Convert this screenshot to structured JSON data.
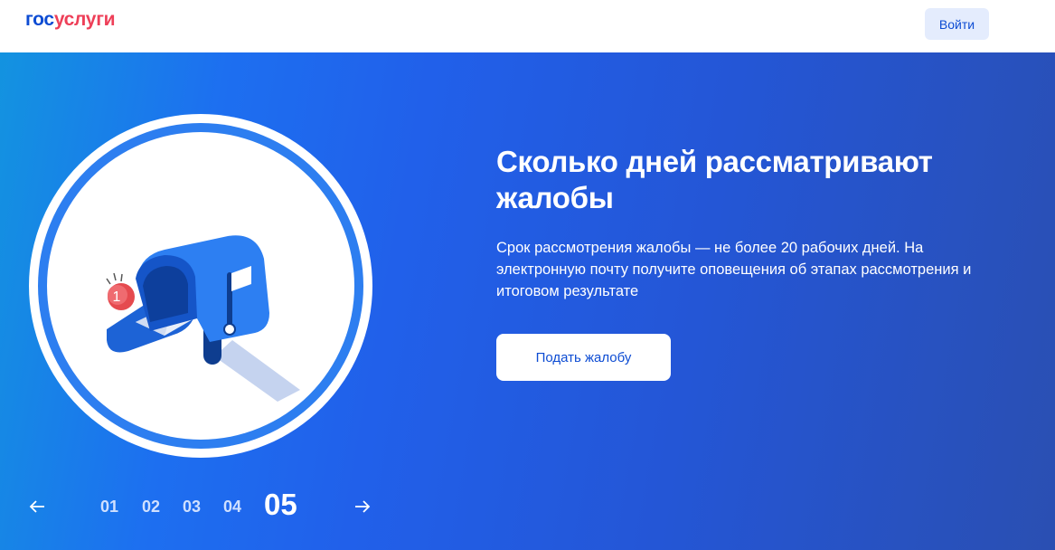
{
  "header": {
    "logo_part1": "гос",
    "logo_part2": "услуги",
    "login_label": "Войти"
  },
  "hero": {
    "title": "Сколько дней рассматривают жалобы",
    "description": "Срок рассмотрения жалобы — не более 20 рабочих дней. На электронную почту получите оповещения об этапах рассмотрения и итоговом результате",
    "cta_label": "Подать жалобу",
    "notification_count": "1"
  },
  "pager": {
    "pages": [
      "01",
      "02",
      "03",
      "04",
      "05"
    ],
    "active_index": 4,
    "prev_icon": "arrow-left-icon",
    "next_icon": "arrow-right-icon"
  },
  "colors": {
    "brand_blue": "#0d4cd3",
    "brand_red": "#ee3f58",
    "hero_start": "#1393e0",
    "hero_end": "#2a4fb2"
  }
}
